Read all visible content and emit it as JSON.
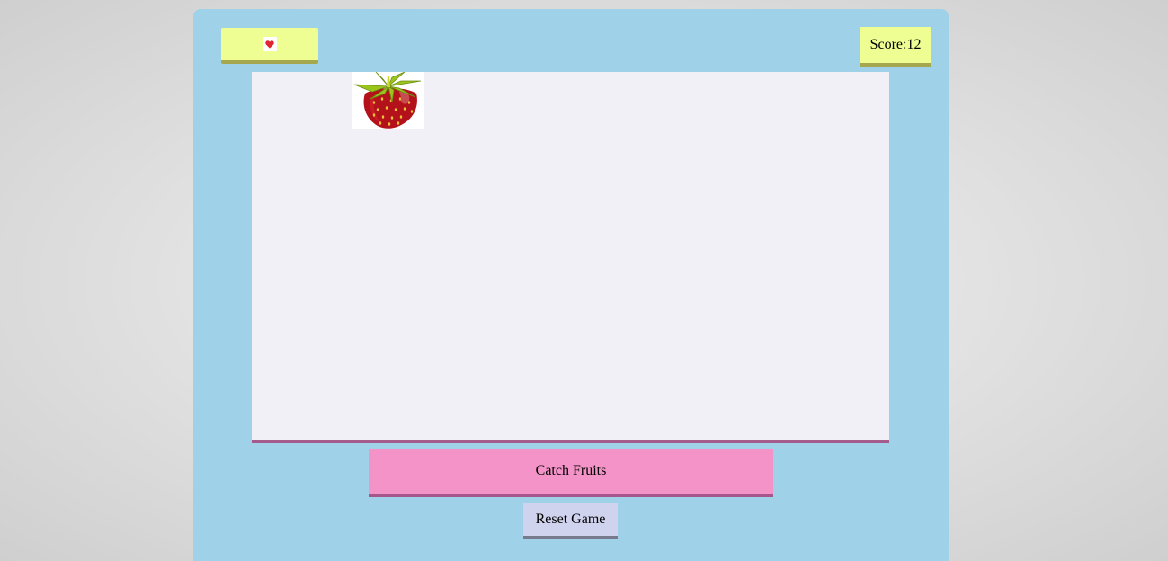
{
  "game": {
    "lives": {
      "icons": [
        "heart-icon"
      ],
      "icon_color": "#e0252f"
    },
    "score": {
      "text": "Score:12",
      "value": 12
    },
    "falling_fruit": "strawberry",
    "buttons": {
      "start_label": "Catch Fruits",
      "reset_label": "Reset Game"
    },
    "colors": {
      "container_bg": "#9fd2e9",
      "play_area_bg": "#f1f0f6",
      "box_bg": "#eefe92",
      "start_bg": "#f393c7",
      "reset_bg": "#d0d3ee"
    }
  }
}
